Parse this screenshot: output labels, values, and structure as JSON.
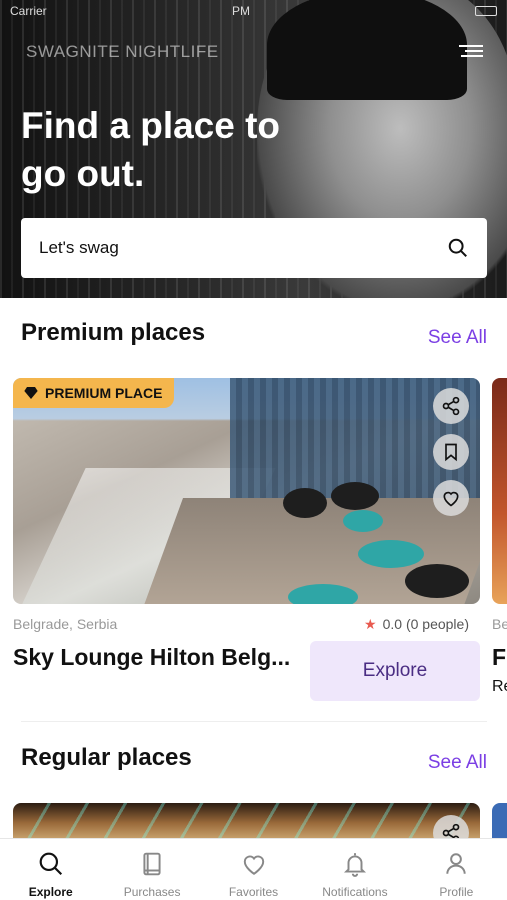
{
  "status_bar": {
    "carrier": "Carrier",
    "time": "PM"
  },
  "header": {
    "brand": "SWAGNITE NIGHTLIFE",
    "headline": "Find a place to go out.",
    "search_text": "Let's swag"
  },
  "premium": {
    "title": "Premium places",
    "see_all": "See All",
    "card": {
      "badge": "PREMIUM PLACE",
      "location": "Belgrade, Serbia",
      "rating": "0.0 (0 people)",
      "name": "Sky Lounge Hilton Belg...",
      "action": "Explore"
    },
    "next_card": {
      "location": "Be",
      "name": "F",
      "sub": "Re"
    }
  },
  "regular": {
    "title": "Regular places",
    "see_all": "See All"
  },
  "tabs": [
    {
      "label": "Explore",
      "icon": "search-icon",
      "active": true
    },
    {
      "label": "Purchases",
      "icon": "book-icon",
      "active": false
    },
    {
      "label": "Favorites",
      "icon": "heart-icon",
      "active": false
    },
    {
      "label": "Notifications",
      "icon": "bell-icon",
      "active": false
    },
    {
      "label": "Profile",
      "icon": "user-icon",
      "active": false
    }
  ],
  "colors": {
    "accent": "#7b3fe4",
    "badge": "#f4b64d",
    "explore_bg": "#efe7fb",
    "star": "#e85a4f"
  }
}
